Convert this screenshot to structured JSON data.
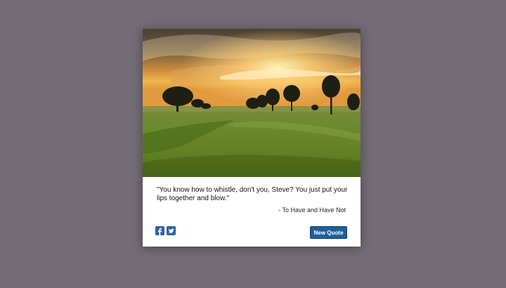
{
  "card": {
    "photo_alt": "Sunset over a grassy field with trees",
    "quote": "\"You know how to whistle, don't you, Steve? You just put your lips together and blow.\"",
    "source": "- To Have and Have Not",
    "new_quote_label": "New Quote"
  },
  "social": {
    "facebook_icon": "facebook-icon",
    "twitter_icon": "twitter-icon"
  },
  "colors": {
    "background": "#736b75",
    "card": "#ffffff",
    "button": "#1f5f9a",
    "social_icon": "#2f63a5"
  }
}
